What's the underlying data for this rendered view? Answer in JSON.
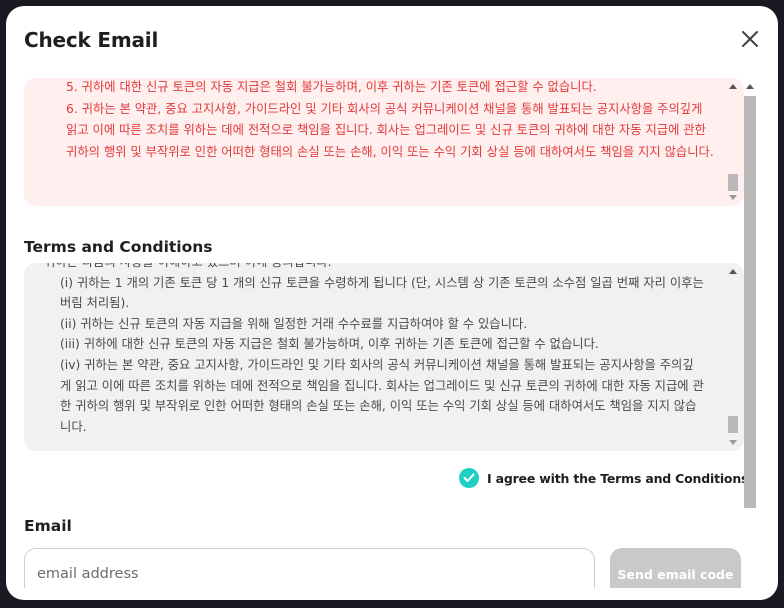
{
  "modal": {
    "title": "Check Email"
  },
  "warning": {
    "items": [
      "5. 귀하에 대한 신규 토큰의 자동 지급은 철회 불가능하며, 이후 귀하는 기존 토큰에 접근할 수 없습니다.",
      "6. 귀하는 본 약관, 중요 고지사항, 가이드라인 및 기타 회사의 공식 커뮤니케이션 채널을 통해 발표되는 공지사항을 주의깊게 읽고 이에 따른 조치를 위하는 데에 전적으로 책임을 집니다. 회사는 업그레이드 및 신규 토큰의 귀하에 대한 자동 지급에 관한 귀하의 행위 및 부작위로 인한 어떠한 형태의 손실 또는 손해, 이익 또는 수익 기회 상실 등에 대하여서도 책임을 지지 않습니다."
    ],
    "colors": {
      "background": "#ffefef",
      "text": "#e23a3a"
    }
  },
  "terms": {
    "heading": "Terms and Conditions",
    "intro": "귀하는 다음의 사항을 이해하고 있으며 이에 동의합니다.",
    "items": [
      "(i) 귀하는 1 개의 기존 토큰 당 1 개의 신규 토큰을 수령하게 됩니다 (단, 시스템 상 기존 토큰의 소수점 일곱 번째 자리 이후는 버림 처리됨).",
      "(ii) 귀하는 신규 토큰의 자동 지급을 위해 일정한 거래 수수료를 지급하여야 할 수 있습니다.",
      "(iii) 귀하에 대한 신규 토큰의 자동 지급은 철회 불가능하며, 이후 귀하는 기존 토큰에 접근할 수 없습니다.",
      "(iv) 귀하는 본 약관, 중요 고지사항, 가이드라인 및 기타 회사의 공식 커뮤니케이션 채널을 통해 발표되는 공지사항을 주의깊게 읽고 이에 따른 조치를 위하는 데에 전적으로 책임을 집니다. 회사는 업그레이드 및 신규 토큰의 귀하에 대한 자동 지급에 관한 귀하의 행위 및 부작위로 인한 어떠한 형태의 손실 또는 손해, 이익 또는 수익 기회 상실 등에 대하여서도 책임을 지지 않습니다."
    ],
    "agree_label": "I agree with the Terms and Conditions",
    "agree_checked": true
  },
  "email": {
    "heading": "Email",
    "value": "",
    "placeholder": "email address",
    "send_label": "Send email code"
  },
  "icons": {
    "close": "close-icon",
    "check": "check-icon"
  },
  "colors": {
    "accent": "#1fcfc1",
    "button_disabled": "#c9c9cc"
  }
}
